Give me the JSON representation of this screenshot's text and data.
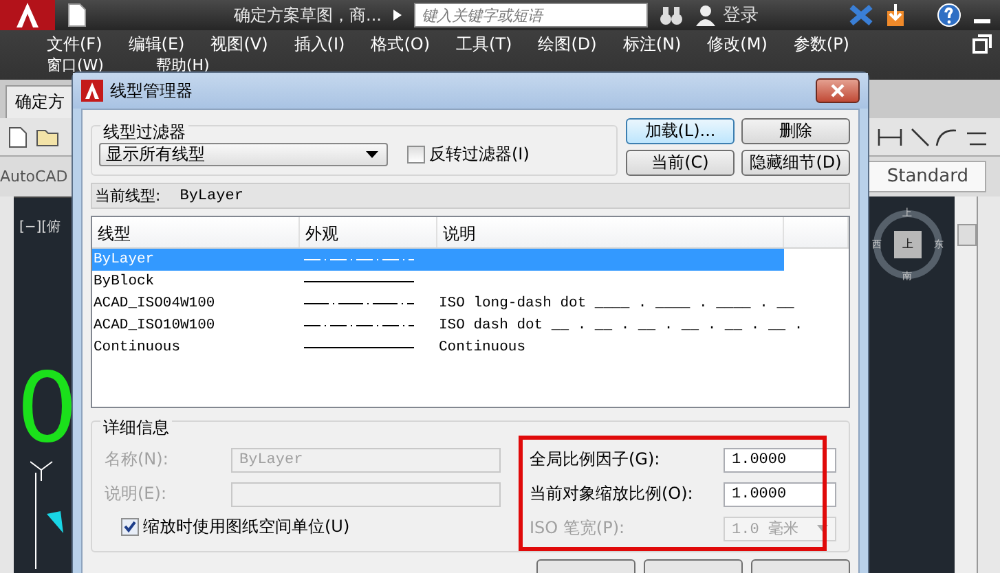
{
  "app": {
    "title": "确定方案草图，商...",
    "search": {
      "placeholder": "键入关键字或短语"
    },
    "user": "登录",
    "menus": [
      "文件(F)",
      "编辑(E)",
      "视图(V)",
      "插入(I)",
      "格式(O)",
      "工具(T)",
      "绘图(D)",
      "标注(N)",
      "修改(M)",
      "参数(P)"
    ],
    "menus_row2": [
      "窗口(W)",
      "帮助(H)"
    ],
    "tab": "确定方",
    "workspace": "AutoCAD",
    "style": "Standard",
    "viewport_label": "[−][俯",
    "drawing_text": "0",
    "compass": {
      "top": "上",
      "left": "西",
      "right": "东",
      "bottom": "南",
      "center": "上"
    }
  },
  "dialog": {
    "title": "线型管理器",
    "filter": {
      "label": "线型过滤器",
      "value": "显示所有线型",
      "invert": {
        "label": "反转过滤器(I)",
        "checked": false
      }
    },
    "buttons": [
      {
        "label": "加载(L)...",
        "focused": true
      },
      {
        "label": "删除",
        "focused": false
      },
      {
        "label": "当前(C)",
        "focused": false
      },
      {
        "label": "隐藏细节(D)",
        "focused": false
      }
    ],
    "current": {
      "label": "当前线型:",
      "value": "ByLayer"
    },
    "table": {
      "columns": [
        "线型",
        "外观",
        "说明"
      ],
      "rows": [
        {
          "name": "ByLayer",
          "kind": "dash_dot",
          "description": "",
          "selected": true
        },
        {
          "name": "ByBlock",
          "kind": "solid",
          "description": "",
          "selected": false
        },
        {
          "name": "ACAD_ISO04W100",
          "kind": "long_dash_dot",
          "description": "ISO long-dash dot ____ . ____ . ____ . __",
          "selected": false
        },
        {
          "name": "ACAD_ISO10W100",
          "kind": "dash_dot",
          "description": "ISO dash dot __ . __ . __ . __ . __ . __ .",
          "selected": false
        },
        {
          "name": "Continuous",
          "kind": "solid",
          "description": "Continuous",
          "selected": false
        }
      ]
    },
    "details": {
      "label": "详细信息",
      "name": {
        "label": "名称(N):",
        "value": "ByLayer",
        "disabled": true
      },
      "desc": {
        "label": "说明(E):",
        "disabled": true
      },
      "paper_space": {
        "label": "缩放时使用图纸空间单位(U)",
        "checked": true
      },
      "global_scale": {
        "label": "全局比例因子(G):",
        "value": "1.0000"
      },
      "object_scale": {
        "label": "当前对象缩放比例(O):",
        "value": "1.0000"
      },
      "pen_width": {
        "label": "ISO 笔宽(P):",
        "value": "1.0 毫米",
        "disabled": true
      }
    }
  }
}
